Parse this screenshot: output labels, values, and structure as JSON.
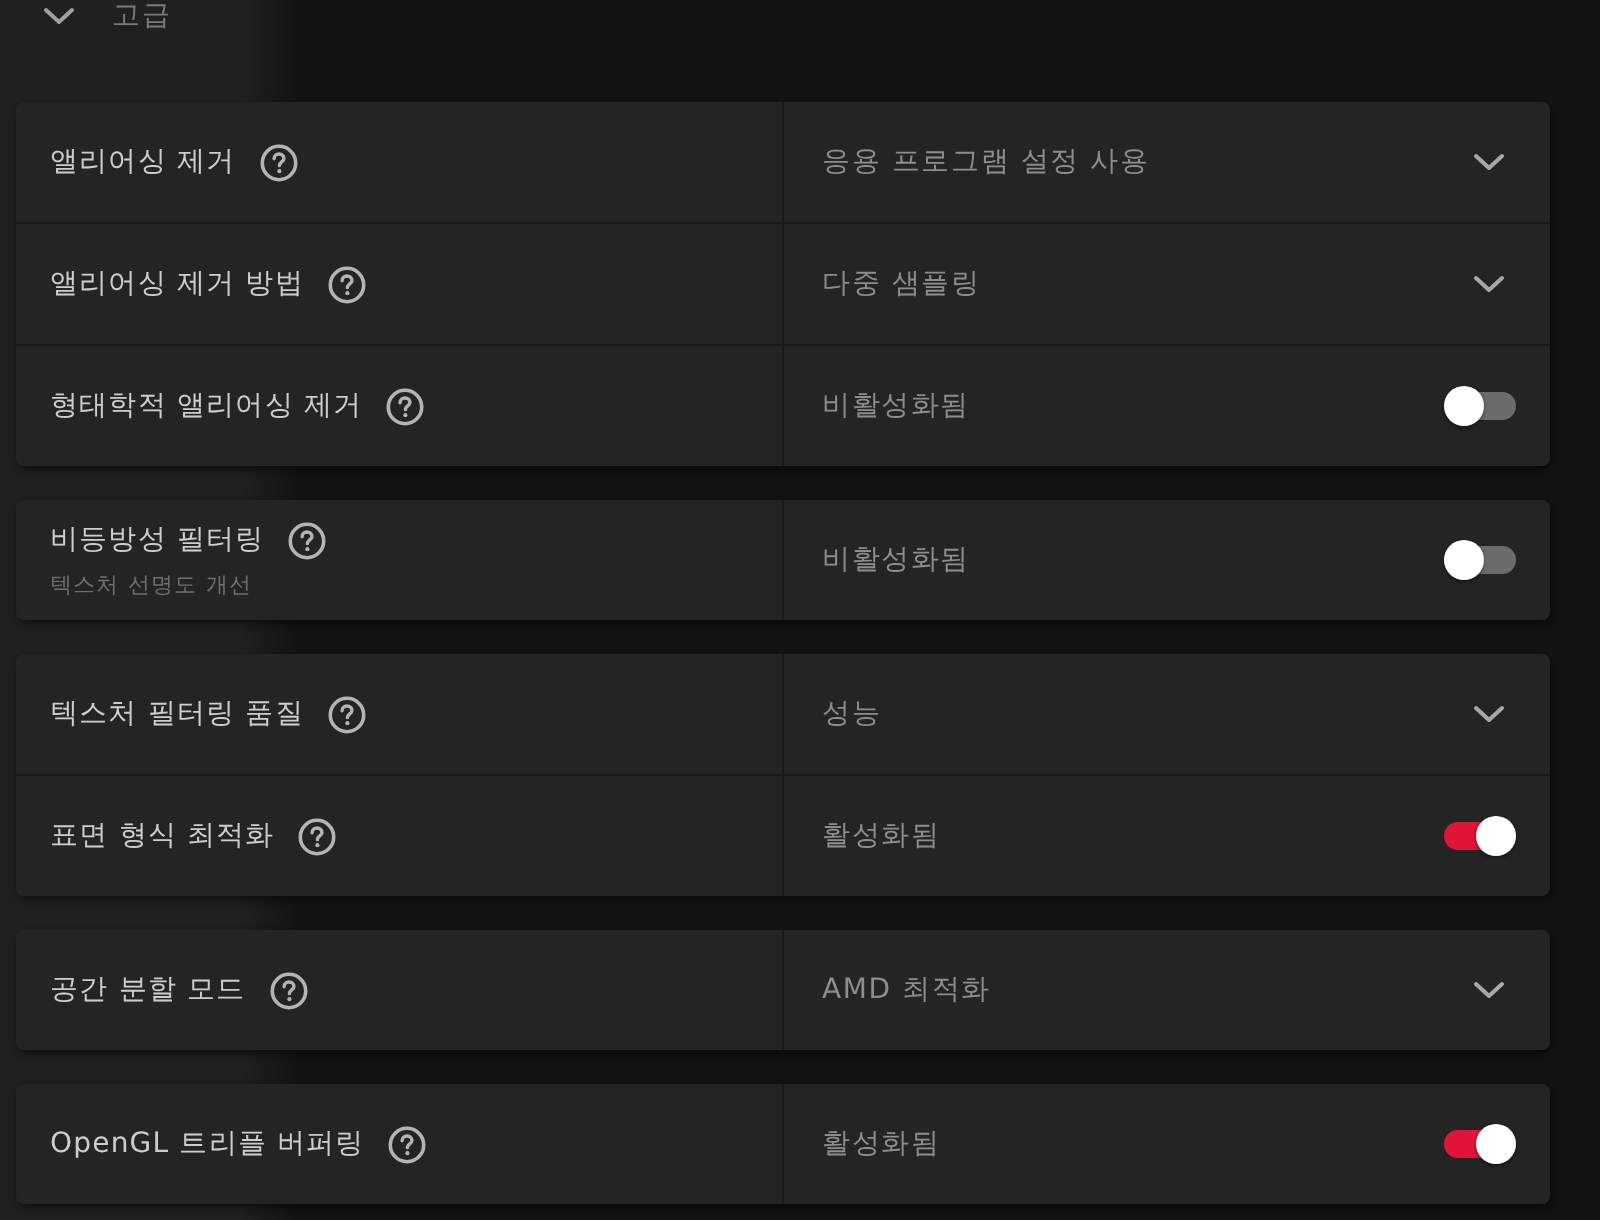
{
  "section": {
    "title": "고급",
    "expanded": true
  },
  "groups": [
    {
      "rows": [
        {
          "label": "앨리어싱 제거",
          "kind": "dropdown",
          "value": "응용 프로그램 설정 사용"
        },
        {
          "label": "앨리어싱 제거 방법",
          "kind": "dropdown",
          "value": "다중 샘플링"
        },
        {
          "label": "형태학적 앨리어싱 제거",
          "kind": "toggle",
          "value": "비활성화됨",
          "on": false
        }
      ]
    },
    {
      "rows": [
        {
          "label": "비등방성 필터링",
          "description": "텍스처 선명도 개선",
          "kind": "toggle",
          "value": "비활성화됨",
          "on": false
        }
      ]
    },
    {
      "rows": [
        {
          "label": "텍스처 필터링 품질",
          "kind": "dropdown",
          "value": "성능"
        },
        {
          "label": "표면 형식 최적화",
          "kind": "toggle",
          "value": "활성화됨",
          "on": true
        }
      ]
    },
    {
      "rows": [
        {
          "label": "공간 분할 모드",
          "kind": "dropdown",
          "value": "AMD 최적화"
        }
      ]
    },
    {
      "rows": [
        {
          "label": "OpenGL 트리플 버퍼링",
          "kind": "toggle",
          "value": "활성화됨",
          "on": true
        }
      ]
    }
  ]
}
